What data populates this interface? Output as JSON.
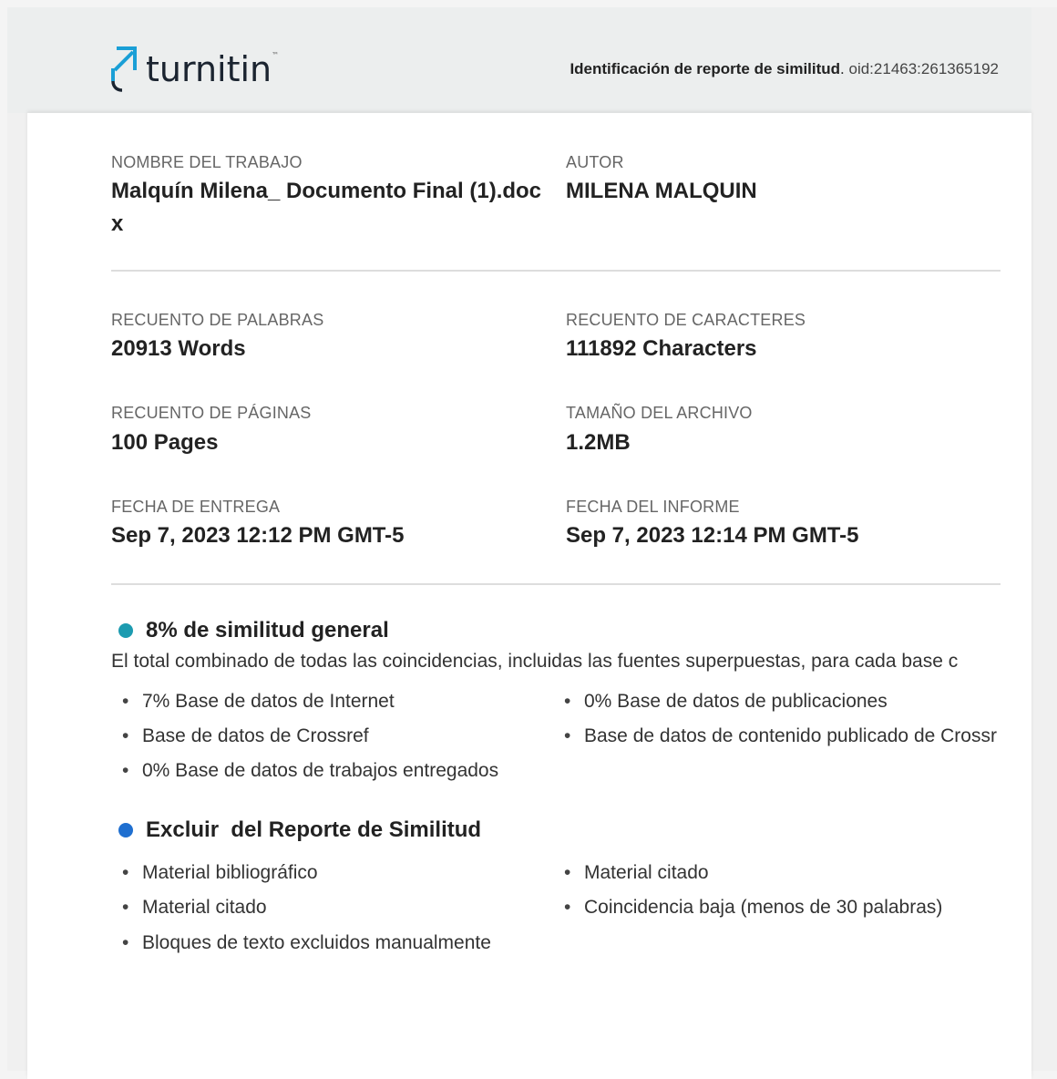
{
  "header": {
    "logo_text": "turnitin",
    "logo_trademark": "™",
    "report_id_label": "Identificación de reporte de similitud",
    "report_id_value": "oid:21463:261365192",
    "accent_color": "#1a9fd6"
  },
  "fields": {
    "job_name": {
      "label": "NOMBRE DEL TRABAJO",
      "value": "Malquín Milena_ Documento Final (1).docx"
    },
    "author": {
      "label": "AUTOR",
      "value": "MILENA MALQUIN"
    },
    "word_count": {
      "label": "RECUENTO DE PALABRAS",
      "value": "20913 Words"
    },
    "char_count": {
      "label": "RECUENTO DE CARACTERES",
      "value": "111892 Characters"
    },
    "page_count": {
      "label": "RECUENTO DE PÁGINAS",
      "value": "100 Pages"
    },
    "file_size": {
      "label": "TAMAÑO DEL ARCHIVO",
      "value": "1.2MB"
    },
    "submission_date": {
      "label": "FECHA DE ENTREGA",
      "value": "Sep 7, 2023 12:12 PM GMT-5"
    },
    "report_date": {
      "label": "FECHA DEL INFORME",
      "value": "Sep 7, 2023 12:14 PM GMT-5"
    }
  },
  "similarity": {
    "title": "8% de similitud general",
    "dot_color": "#1c9bb0",
    "description": "El total combinado de todas las coincidencias, incluidas las fuentes superpuestas, para cada base c",
    "items": [
      "7% Base de datos de Internet",
      "0% Base de datos de publicaciones",
      "Base de datos de Crossref",
      "Base de datos de contenido publicado de Crossr",
      "0% Base de datos de trabajos entregados"
    ]
  },
  "exclusions": {
    "title": "Excluir  del Reporte de Similitud",
    "dot_color": "#1f6fd0",
    "items": [
      "Material bibliográfico",
      "Material citado",
      "Material citado",
      "Coincidencia baja (menos de 30 palabras)",
      "Bloques de texto excluidos manualmente"
    ]
  }
}
